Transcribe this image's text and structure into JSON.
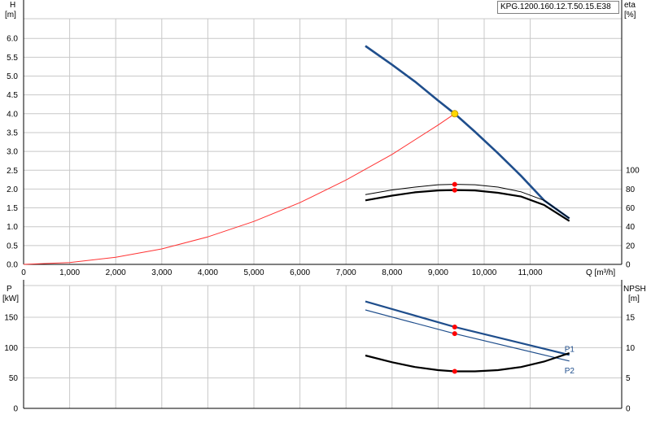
{
  "model": "KPG.1200.160.12.T.50.15.E38",
  "axis_labels": {
    "h_name": "H",
    "h_unit": "[m]",
    "eta_name": "eta",
    "eta_unit": "[%]",
    "q_label": "Q [m³/h]",
    "p_name": "P",
    "p_unit": "[kW]",
    "npsh_name": "NPSH",
    "npsh_unit": "[m]"
  },
  "colors": {
    "pump_curve": "#1f4e8c",
    "system_curve": "#ff3333",
    "efficiency": "#000000",
    "power": "#1f4e8c",
    "npsh": "#000000",
    "duty_marker": "#ff0000",
    "operating_point": "#ffd700",
    "grid": "#c8c8c8"
  },
  "chart_data": [
    {
      "type": "line",
      "panel": "upper",
      "xlim": [
        0,
        12200
      ],
      "ylim": [
        0,
        6.5
      ],
      "y2lim": [
        0,
        140
      ],
      "x_ticks": [
        0,
        1000,
        2000,
        3000,
        4000,
        5000,
        6000,
        7000,
        8000,
        9000,
        10000,
        11000
      ],
      "x_tick_labels": [
        "0",
        "1,000",
        "2,000",
        "3,000",
        "4,000",
        "5,000",
        "6,000",
        "7,000",
        "8,000",
        "9,000",
        "10,000",
        "11,000"
      ],
      "y_ticks": [
        0,
        0.5,
        1,
        1.5,
        2,
        2.5,
        3,
        3.5,
        4,
        4.5,
        5,
        5.5,
        6
      ],
      "y_tick_labels": [
        "0.0",
        "0.5",
        "1.0",
        "1.5",
        "2.0",
        "2.5",
        "3.0",
        "3.5",
        "4.0",
        "4.5",
        "5.0",
        "5.5",
        "6.0"
      ],
      "y2_ticks": [
        0,
        20,
        40,
        60,
        80,
        100
      ],
      "y2_tick_labels": [
        "0",
        "20",
        "40",
        "60",
        "80",
        "100"
      ],
      "grid": true,
      "series": [
        {
          "key": "pump_head",
          "axis": "y",
          "x": [
            7420,
            8000,
            8500,
            9000,
            9360,
            9800,
            10300,
            10800,
            11300,
            11850
          ],
          "y": [
            5.8,
            5.3,
            4.85,
            4.35,
            4.0,
            3.52,
            2.95,
            2.35,
            1.7,
            1.22
          ]
        },
        {
          "key": "system_head",
          "axis": "y",
          "x": [
            0,
            1000,
            2000,
            3000,
            4000,
            5000,
            6000,
            7000,
            8000,
            9000,
            9360
          ],
          "y": [
            0,
            0.05,
            0.19,
            0.41,
            0.73,
            1.14,
            1.64,
            2.24,
            2.92,
            3.7,
            4.0
          ]
        },
        {
          "key": "eta_upper",
          "axis": "y2",
          "x": [
            7420,
            8000,
            8500,
            9000,
            9360,
            9800,
            10300,
            10800,
            11300,
            11850
          ],
          "y": [
            74,
            79,
            82,
            84.5,
            85,
            84.5,
            82,
            77,
            68,
            49
          ]
        },
        {
          "key": "eta_lower",
          "axis": "y2",
          "x": [
            7420,
            8000,
            8500,
            9000,
            9360,
            9800,
            10300,
            10800,
            11300,
            11850
          ],
          "y": [
            68,
            73,
            76.5,
            78.5,
            78.8,
            78.5,
            76,
            72,
            63,
            46
          ]
        }
      ],
      "markers": [
        {
          "x": 9360,
          "y": 4.0,
          "axis": "y",
          "kind": "operating_point"
        },
        {
          "x": 9360,
          "y": 85,
          "axis": "y2",
          "kind": "duty"
        },
        {
          "x": 9360,
          "y": 78.8,
          "axis": "y2",
          "kind": "duty"
        }
      ]
    },
    {
      "type": "line",
      "panel": "lower",
      "xlim": [
        0,
        12200
      ],
      "ylim": [
        0,
        200
      ],
      "y2lim": [
        0,
        20
      ],
      "y_ticks": [
        0,
        50,
        100,
        150
      ],
      "y_tick_labels": [
        "0",
        "50",
        "100",
        "150"
      ],
      "y2_ticks": [
        0,
        5,
        10,
        15
      ],
      "y2_tick_labels": [
        "0",
        "5",
        "10",
        "15"
      ],
      "grid": true,
      "series": [
        {
          "key": "P1",
          "name": "P1",
          "axis": "y",
          "x": [
            7420,
            9360,
            11850
          ],
          "y": [
            176,
            134,
            88
          ]
        },
        {
          "key": "P2",
          "name": "P2",
          "axis": "y",
          "x": [
            7420,
            9360,
            11850
          ],
          "y": [
            162,
            123,
            78
          ]
        },
        {
          "key": "npsh",
          "axis": "y2",
          "x": [
            7420,
            8000,
            8500,
            9000,
            9360,
            9800,
            10300,
            10800,
            11300,
            11850
          ],
          "y": [
            8.7,
            7.6,
            6.8,
            6.3,
            6.1,
            6.1,
            6.3,
            6.8,
            7.7,
            9.1
          ]
        }
      ],
      "markers": [
        {
          "x": 9360,
          "y": 134,
          "axis": "y",
          "kind": "duty"
        },
        {
          "x": 9360,
          "y": 123,
          "axis": "y",
          "kind": "duty"
        },
        {
          "x": 9360,
          "y": 6.1,
          "axis": "y2",
          "kind": "duty"
        }
      ]
    }
  ]
}
